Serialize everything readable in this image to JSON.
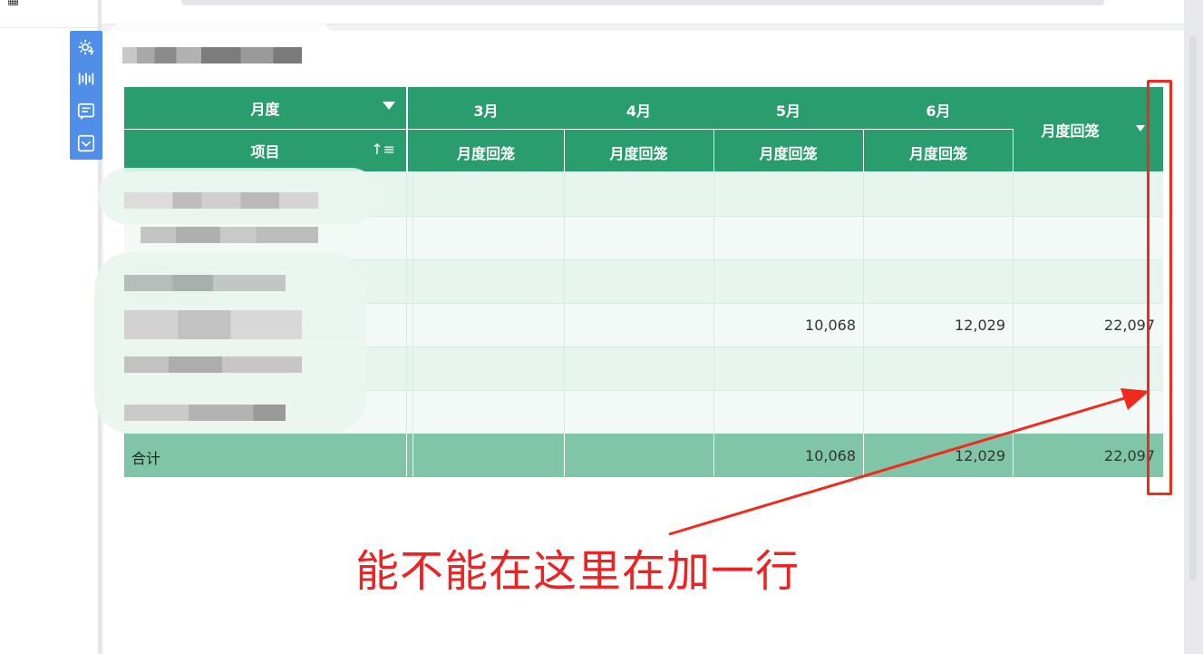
{
  "header": {
    "month_label": "月度",
    "item_label": "项目",
    "months": [
      "3月",
      "4月",
      "5月",
      "6月"
    ],
    "sub_label": "月度回笼",
    "total_col_label": "月度回笼"
  },
  "rows": [
    {
      "v5": "",
      "v6": "",
      "total": ""
    },
    {
      "v5": "",
      "v6": "",
      "total": ""
    },
    {
      "v5": "",
      "v6": "",
      "total": ""
    },
    {
      "v5": "10,068",
      "v6": "12,029",
      "total": "22,097"
    },
    {
      "v5": "",
      "v6": "",
      "total": ""
    },
    {
      "v5": "",
      "v6": "",
      "total": ""
    }
  ],
  "total_row": {
    "label": "合计",
    "v5": "10,068",
    "v6": "12,029",
    "total": "22,097"
  },
  "annotation": "能不能在这里在加一行",
  "colors": {
    "header_green": "#2a9d6e",
    "total_green": "#80c5a7",
    "annotation_red": "#f02a1c",
    "toolbar_blue": "#4f8fe8"
  },
  "toolbar_icons": [
    "gear-bolt-icon",
    "barcode-icon",
    "comment-icon",
    "collapse-icon"
  ]
}
